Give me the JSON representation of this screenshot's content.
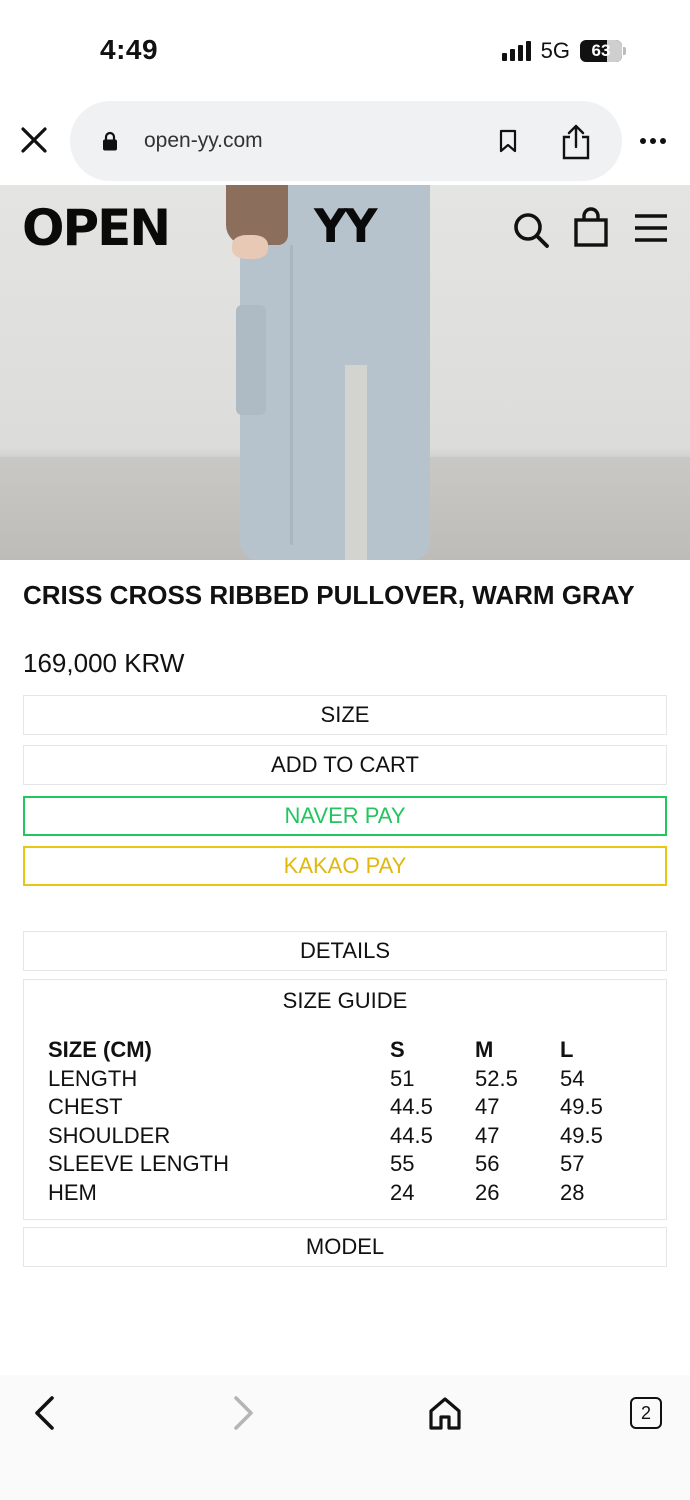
{
  "status_bar": {
    "time": "4:49",
    "network": "5G",
    "battery": "63"
  },
  "browser": {
    "url": "open-yy.com",
    "icons": [
      "close-icon",
      "lock-icon",
      "bookmark-icon",
      "share-icon",
      "more-icon"
    ]
  },
  "site_header": {
    "logo_left": "OPEN",
    "logo_right": "YY",
    "icons": [
      "search-icon",
      "shopping-bag-icon",
      "menu-icon"
    ]
  },
  "product": {
    "title": "CRISS CROSS RIBBED PULLOVER, WARM GRAY",
    "price": "169,000 KRW"
  },
  "buttons": {
    "size": "SIZE",
    "add_to_cart": "ADD TO CART",
    "naver_pay": "NAVER PAY",
    "kakao_pay": "KAKAO PAY",
    "details": "DETAILS",
    "model": "MODEL"
  },
  "size_guide": {
    "title": "SIZE GUIDE",
    "headers": [
      "SIZE (CM)",
      "S",
      "M",
      "L"
    ],
    "rows": [
      [
        "LENGTH",
        "51",
        "52.5",
        "54"
      ],
      [
        "CHEST",
        "44.5",
        "47",
        "49.5"
      ],
      [
        "SHOULDER",
        "44.5",
        "47",
        "49.5"
      ],
      [
        "SLEEVE LENGTH",
        "55",
        "56",
        "57"
      ],
      [
        "HEM",
        "24",
        "26",
        "28"
      ]
    ]
  },
  "toolbar": {
    "tab_count": "2",
    "icons": [
      "back-icon",
      "forward-icon",
      "home-icon",
      "tabs-icon"
    ]
  },
  "colors": {
    "naver": "#22c55e",
    "kakao": "#e9c612",
    "border": "#e6e6e6"
  }
}
